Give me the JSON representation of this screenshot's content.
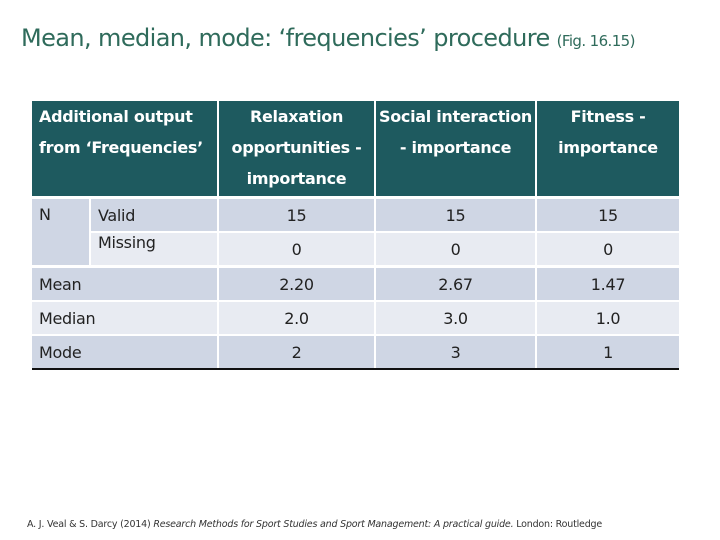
{
  "slide": {
    "title": "Mean, median, mode: ‘frequencies’ procedure",
    "figure_ref": "(Fig. 16.15)"
  },
  "table": {
    "header": {
      "label": "Additional output from ‘Frequencies’",
      "label_line1": "Additional output",
      "label_line2": "from ‘Frequencies’",
      "columns": [
        {
          "line1": "Relaxation",
          "line2": "opportunities -",
          "line3": "importance"
        },
        {
          "line1": "Social interaction",
          "line2": "- importance",
          "line3": ""
        },
        {
          "line1": "Fitness -",
          "line2": "importance",
          "line3": ""
        }
      ]
    },
    "n_label": "N",
    "rows": [
      {
        "label": "Valid",
        "values": [
          "15",
          "15",
          "15"
        ]
      },
      {
        "label": "Missing",
        "values": [
          "0",
          "0",
          "0"
        ]
      },
      {
        "label": "Mean",
        "values": [
          "2.20",
          "2.67",
          "1.47"
        ]
      },
      {
        "label": "Median",
        "values": [
          "2.0",
          "3.0",
          "1.0"
        ]
      },
      {
        "label": "Mode",
        "values": [
          "2",
          "3",
          "1"
        ]
      }
    ]
  },
  "citation": {
    "authors": "A. J. Veal & S. Darcy (2014)",
    "book_title": "Research Methods for Sport Studies and Sport Management: A practical guide.",
    "publisher": "London: Routledge"
  },
  "colors": {
    "title": "#2f6b5b",
    "header_bg": "#1e5a5f",
    "row_dark": "#cfd6e4",
    "row_light": "#e8ebf2"
  }
}
